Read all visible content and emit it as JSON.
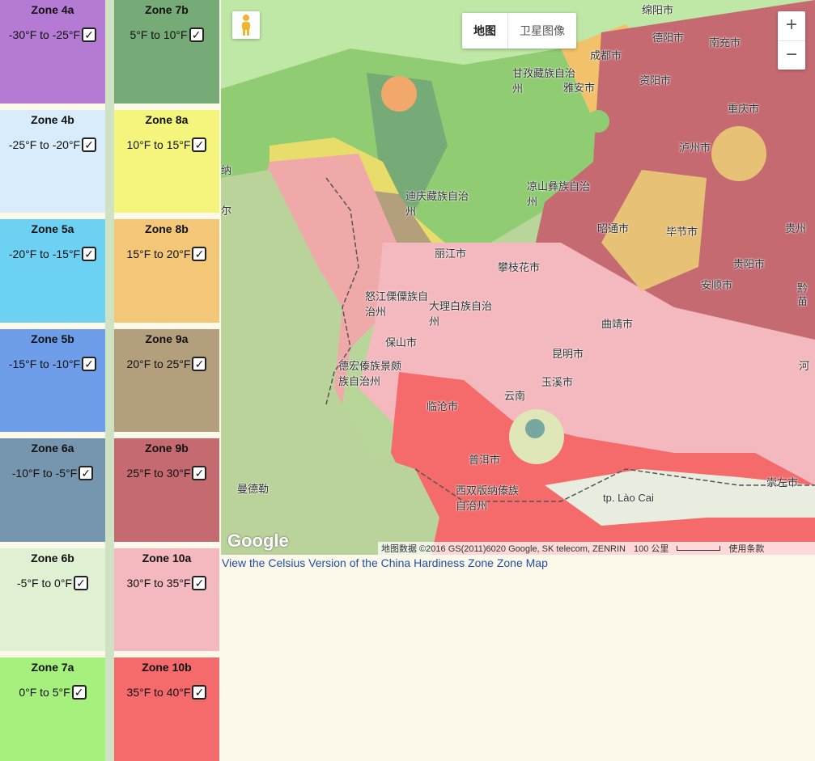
{
  "legend": {
    "left": [
      {
        "name": "Zone 4a",
        "range": "-30°F to -25°F",
        "color": "#b57bd4"
      },
      {
        "name": "Zone 4b",
        "range": "-25°F to -20°F",
        "color": "#d8ecfb"
      },
      {
        "name": "Zone 5a",
        "range": "-20°F to -15°F",
        "color": "#6dd1f4"
      },
      {
        "name": "Zone 5b",
        "range": "-15°F to -10°F",
        "color": "#6e9eea"
      },
      {
        "name": "Zone 6a",
        "range": "-10°F to -5°F",
        "color": "#7695af"
      },
      {
        "name": "Zone 6b",
        "range": "-5°F to 0°F",
        "color": "#dff0d3"
      },
      {
        "name": "Zone 7a",
        "range": "0°F to 5°F",
        "color": "#a6f07d"
      }
    ],
    "right": [
      {
        "name": "Zone 7b",
        "range": "5°F to 10°F",
        "color": "#76ab78"
      },
      {
        "name": "Zone 8a",
        "range": "10°F to 15°F",
        "color": "#f5f57d"
      },
      {
        "name": "Zone 8b",
        "range": "15°F to 20°F",
        "color": "#f3c678"
      },
      {
        "name": "Zone 9a",
        "range": "20°F to 25°F",
        "color": "#b39f7c"
      },
      {
        "name": "Zone 9b",
        "range": "25°F to 30°F",
        "color": "#c66a72"
      },
      {
        "name": "Zone 10a",
        "range": "30°F to 35°F",
        "color": "#f4b8bf"
      },
      {
        "name": "Zone 10b",
        "range": "35°F to 40°F",
        "color": "#f56a6a"
      }
    ],
    "checkbox_glyph": "✓"
  },
  "map": {
    "type_controls": {
      "map": "地图",
      "satellite": "卫星图像"
    },
    "zoom": {
      "in": "+",
      "out": "−"
    },
    "labels": [
      "绵阳市",
      "德阳市",
      "南充市",
      "成都市",
      "资阳市",
      "甘孜藏族自治州",
      "雅安市",
      "重庆市",
      "泸州市",
      "迪庆藏族自治州",
      "凉山彝族自治州",
      "昭通市",
      "毕节市",
      "丽江市",
      "攀枝花市",
      "贵阳市",
      "安顺市",
      "怒江傈僳族自治州",
      "大理白族自治州",
      "曲靖市",
      "保山市",
      "昆明市",
      "德宏傣族景颇族自治州",
      "玉溪市",
      "云南",
      "临沧市",
      "普洱市",
      "西双版纳傣族自治州",
      "曼德勒",
      "tp. Lào Cai",
      "崇左市",
      "贵州",
      "纳",
      "尔",
      "河",
      "黔",
      "苗"
    ],
    "google": "Google",
    "attribution": "地图数据 ©2016 GS(2011)6020 Google, SK telecom, ZENRIN",
    "scale": "100 公里",
    "terms": "使用条款"
  },
  "celsius_link": "View the Celsius Version of the China Hardiness Zone Zone Map"
}
